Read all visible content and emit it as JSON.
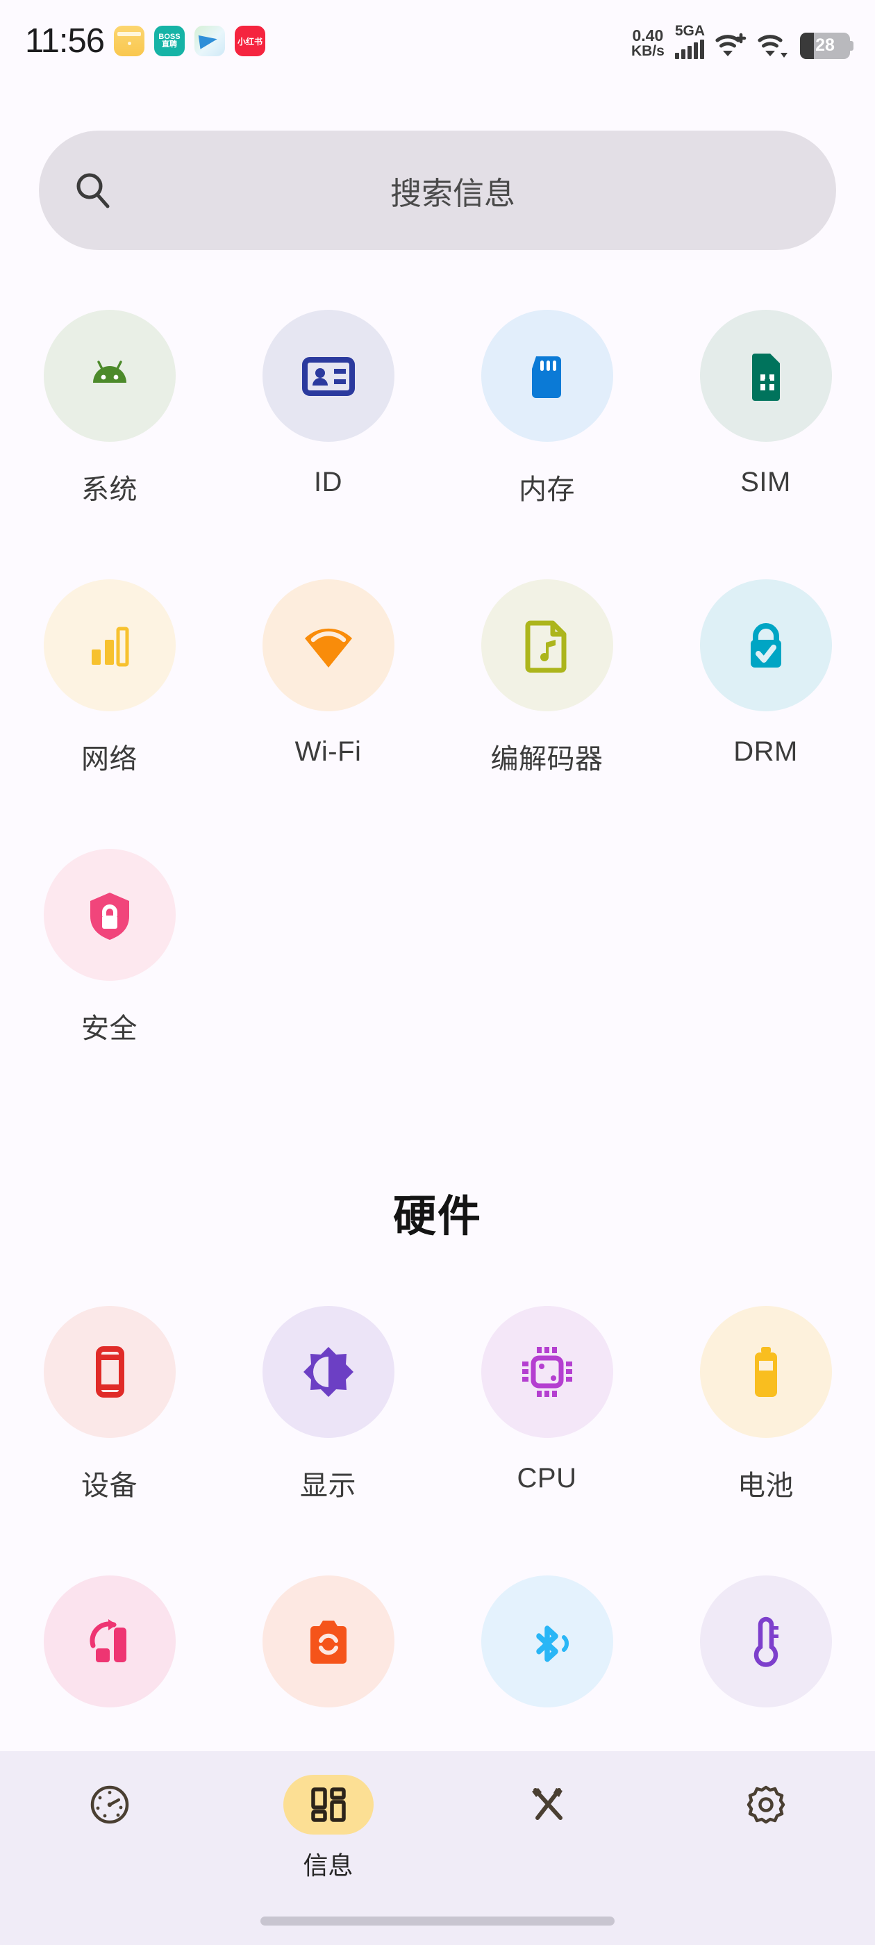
{
  "status_bar": {
    "clock": "11:56",
    "app_icons": [
      {
        "name": "wallet-app-icon",
        "label": ""
      },
      {
        "name": "boss-zhipin-app-icon",
        "label": "BOSS\n直聘"
      },
      {
        "name": "telegram-app-icon",
        "label": ""
      },
      {
        "name": "xiaohongshu-app-icon",
        "label": "小红书"
      }
    ],
    "network_speed_value": "0.40",
    "network_speed_unit": "KB/s",
    "signal_label": "5GA",
    "signal_bars": 5,
    "wifi_primary": "wifi-plus-icon",
    "wifi_secondary": "wifi-icon",
    "battery_percent": "28"
  },
  "search": {
    "placeholder": "搜索信息",
    "icon": "search-icon"
  },
  "sections": [
    {
      "id": "software",
      "title": "",
      "items": [
        {
          "label": "系统",
          "icon": "android-icon",
          "bg": "#e9efe6",
          "fg": "#4c8a2a"
        },
        {
          "label": "ID",
          "icon": "id-card-icon",
          "bg": "#e6e6f2",
          "fg": "#2b3a9e"
        },
        {
          "label": "内存",
          "icon": "sd-card-icon",
          "bg": "#e2eefb",
          "fg": "#0b7ad6"
        },
        {
          "label": "SIM",
          "icon": "sim-card-icon",
          "bg": "#e4ecea",
          "fg": "#00735c"
        },
        {
          "label": "网络",
          "icon": "signal-bars-icon",
          "bg": "#fdf3e2",
          "fg": "#f7c12e"
        },
        {
          "label": "Wi-Fi",
          "icon": "wifi-fan-icon",
          "bg": "#fdeddd",
          "fg": "#f98c0a"
        },
        {
          "label": "编解码器",
          "icon": "music-file-icon",
          "bg": "#f2f2e5",
          "fg": "#acb51c"
        },
        {
          "label": "DRM",
          "icon": "lock-check-icon",
          "bg": "#def0f6",
          "fg": "#00a5c4"
        },
        {
          "label": "安全",
          "icon": "shield-lock-icon",
          "bg": "#fde8ef",
          "fg": "#f1457b"
        }
      ]
    },
    {
      "id": "hardware",
      "title": "硬件",
      "items": [
        {
          "label": "设备",
          "icon": "phone-icon",
          "bg": "#fbe8e8",
          "fg": "#e02b28"
        },
        {
          "label": "显示",
          "icon": "brightness-icon",
          "bg": "#ece4f7",
          "fg": "#6c3fc4"
        },
        {
          "label": "CPU",
          "icon": "cpu-chip-icon",
          "bg": "#f4e7f8",
          "fg": "#b43fd0"
        },
        {
          "label": "电池",
          "icon": "battery-icon",
          "bg": "#fdf1dc",
          "fg": "#f9be1f"
        },
        {
          "label": "",
          "icon": "sensor-rotation-icon",
          "bg": "#fbe3ee",
          "fg": "#ee3572"
        },
        {
          "label": "",
          "icon": "camera-icon",
          "bg": "#fde8e2",
          "fg": "#f5541a"
        },
        {
          "label": "",
          "icon": "bluetooth-icon",
          "bg": "#e4f2fd",
          "fg": "#29b6f6"
        },
        {
          "label": "",
          "icon": "thermometer-icon",
          "bg": "#f0eaf7",
          "fg": "#7d3fcc"
        }
      ]
    }
  ],
  "bottom_nav": {
    "items": [
      {
        "label": "",
        "icon": "speedometer-icon",
        "active": false
      },
      {
        "label": "信息",
        "icon": "dashboard-grid-icon",
        "active": true
      },
      {
        "label": "",
        "icon": "tools-icon",
        "active": false
      },
      {
        "label": "",
        "icon": "gear-icon",
        "active": false
      }
    ],
    "active_pill_color": "#fcdf94"
  }
}
